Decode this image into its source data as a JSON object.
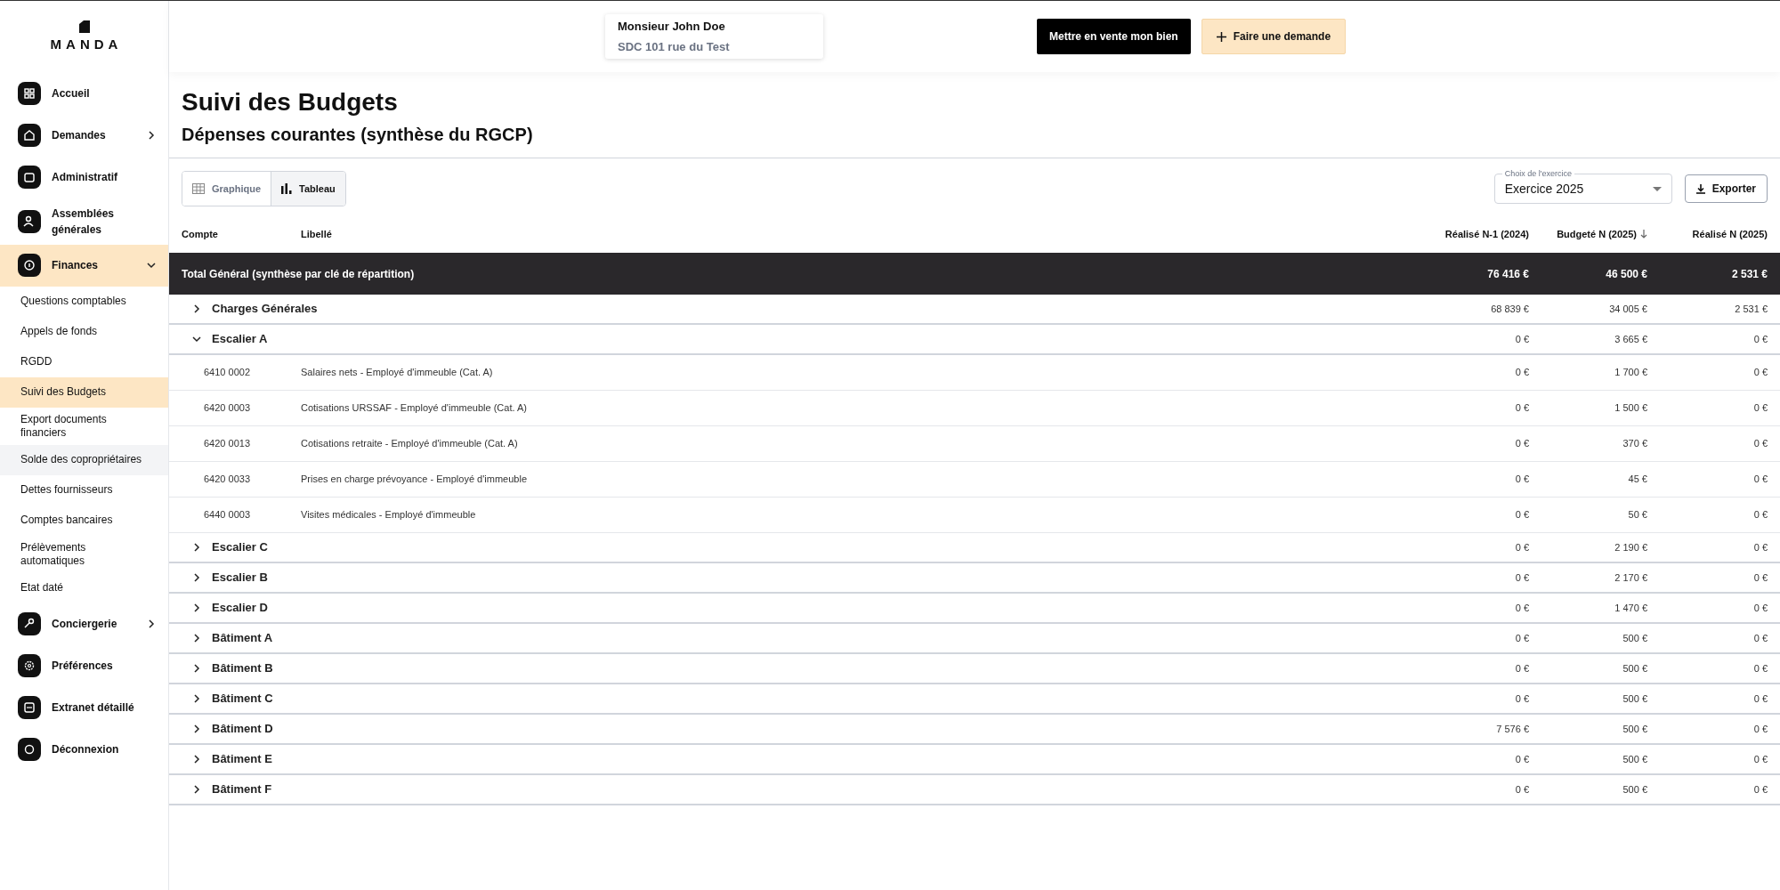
{
  "logo": {
    "text": "MANDA"
  },
  "sidebar": {
    "items": [
      {
        "kind": "main",
        "label": "Accueil",
        "selected": false
      },
      {
        "kind": "main",
        "label": "Demandes",
        "selected": false,
        "expanded": false
      },
      {
        "kind": "main",
        "label": "Administratif",
        "selected": false
      },
      {
        "kind": "main",
        "label": "Assemblées générales",
        "selected": false
      },
      {
        "kind": "main",
        "label": "Finances",
        "selected": true,
        "expanded": true
      },
      {
        "kind": "sub",
        "label": "Questions comptables",
        "selected": false,
        "hovered": false
      },
      {
        "kind": "sub",
        "label": "Appels de fonds",
        "selected": false,
        "hovered": false
      },
      {
        "kind": "sub",
        "label": "RGDD",
        "selected": false,
        "hovered": false
      },
      {
        "kind": "sub",
        "label": "Suivi des Budgets",
        "selected": true,
        "hovered": false
      },
      {
        "kind": "sub",
        "label": "Export documents financiers",
        "selected": false,
        "hovered": false
      },
      {
        "kind": "sub",
        "label": "Solde des copropriétaires",
        "selected": false,
        "hovered": true
      },
      {
        "kind": "sub",
        "label": "Dettes fournisseurs",
        "selected": false,
        "hovered": false
      },
      {
        "kind": "sub",
        "label": "Comptes bancaires",
        "selected": false,
        "hovered": false
      },
      {
        "kind": "sub",
        "label": "Prélèvements automatiques",
        "selected": false,
        "hovered": false
      },
      {
        "kind": "sub",
        "label": "Etat daté",
        "selected": false,
        "hovered": false
      },
      {
        "kind": "main",
        "label": "Conciergerie",
        "selected": false,
        "expanded": false
      },
      {
        "kind": "main",
        "label": "Préférences",
        "selected": false
      },
      {
        "kind": "main",
        "label": "Extranet détaillé",
        "selected": false
      },
      {
        "kind": "main",
        "label": "Déconnexion",
        "selected": false
      }
    ]
  },
  "header": {
    "account": {
      "name": "Monsieur John Doe",
      "property": "SDC 101 rue du Test"
    },
    "buttons": [
      {
        "kind": "primary",
        "label": "Mettre en vente mon bien"
      },
      {
        "kind": "secondary",
        "label": "Faire une demande"
      }
    ]
  },
  "page": {
    "title": "Suivi des Budgets",
    "subtitle": "Dépenses courantes (synthèse du RGCP)"
  },
  "view_toggle": [
    {
      "label": "Graphique",
      "selected": false
    },
    {
      "label": "Tableau",
      "selected": true
    }
  ],
  "year_select": {
    "label": "Choix de l'exercice",
    "value": "Exercice 2025"
  },
  "export_button": {
    "label": "Exporter"
  },
  "table": {
    "columns": [
      {
        "label": "Compte",
        "sorted": false
      },
      {
        "label": "Libellé",
        "sorted": false
      },
      {
        "label": "Réalisé N-1 (2024)",
        "sorted": false
      },
      {
        "label": "Budgeté N (2025)",
        "sorted": true
      },
      {
        "label": "Réalisé N (2025)",
        "sorted": false
      }
    ],
    "rows": [
      {
        "kind": "total",
        "label": "Total Général (synthèse par clé de répartition)",
        "values": [
          "76 416 €",
          "46 500 €",
          "2 531 €"
        ]
      },
      {
        "kind": "group",
        "label": "Charges Générales",
        "expanded": false,
        "values": [
          "68 839 €",
          "34 005 €",
          "2 531 €"
        ]
      },
      {
        "kind": "group",
        "label": "Escalier A",
        "expanded": true,
        "values": [
          "0 €",
          "3 665 €",
          "0 €"
        ]
      },
      {
        "kind": "account",
        "account": "6410 0002",
        "label": "Salaires nets - Employé d'immeuble (Cat. A)",
        "values": [
          "0 €",
          "1 700 €",
          "0 €"
        ]
      },
      {
        "kind": "account",
        "account": "6420 0003",
        "label": "Cotisations URSSAF - Employé d'immeuble (Cat. A)",
        "values": [
          "0 €",
          "1 500 €",
          "0 €"
        ]
      },
      {
        "kind": "account",
        "account": "6420 0013",
        "label": "Cotisations retraite - Employé d'immeuble (Cat. A)",
        "values": [
          "0 €",
          "370 €",
          "0 €"
        ]
      },
      {
        "kind": "account",
        "account": "6420 0033",
        "label": "Prises en charge prévoyance - Employé d'immeuble",
        "values": [
          "0 €",
          "45 €",
          "0 €"
        ]
      },
      {
        "kind": "account",
        "account": "6440 0003",
        "label": "Visites médicales - Employé d'immeuble",
        "values": [
          "0 €",
          "50 €",
          "0 €"
        ]
      },
      {
        "kind": "group",
        "label": "Escalier C",
        "expanded": false,
        "values": [
          "0 €",
          "2 190 €",
          "0 €"
        ]
      },
      {
        "kind": "group",
        "label": "Escalier B",
        "expanded": false,
        "values": [
          "0 €",
          "2 170 €",
          "0 €"
        ]
      },
      {
        "kind": "group",
        "label": "Escalier D",
        "expanded": false,
        "values": [
          "0 €",
          "1 470 €",
          "0 €"
        ]
      },
      {
        "kind": "group",
        "label": "Bâtiment A",
        "expanded": false,
        "values": [
          "0 €",
          "500 €",
          "0 €"
        ]
      },
      {
        "kind": "group",
        "label": "Bâtiment B",
        "expanded": false,
        "values": [
          "0 €",
          "500 €",
          "0 €"
        ]
      },
      {
        "kind": "group",
        "label": "Bâtiment C",
        "expanded": false,
        "values": [
          "0 €",
          "500 €",
          "0 €"
        ]
      },
      {
        "kind": "group",
        "label": "Bâtiment D",
        "expanded": false,
        "values": [
          "7 576 €",
          "500 €",
          "0 €"
        ]
      },
      {
        "kind": "group",
        "label": "Bâtiment E",
        "expanded": false,
        "values": [
          "0 €",
          "500 €",
          "0 €"
        ]
      },
      {
        "kind": "group",
        "label": "Bâtiment F",
        "expanded": false,
        "values": [
          "0 €",
          "500 €",
          "0 €"
        ]
      }
    ]
  }
}
